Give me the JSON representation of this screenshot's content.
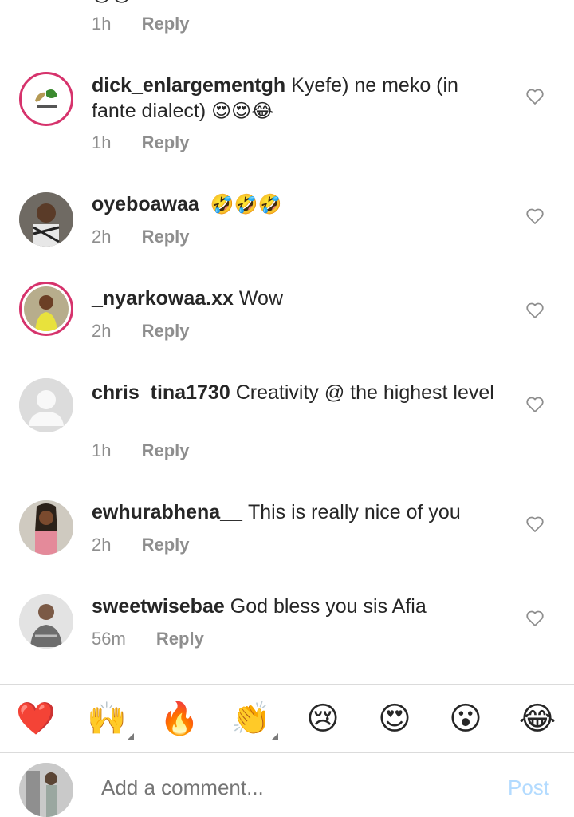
{
  "top_comment": {
    "time": "1h",
    "reply": "Reply",
    "emoji": "😍😍"
  },
  "comments": [
    {
      "username": "dick_enlargementgh",
      "text": "Kyefe) ne meko (in fante dialect)",
      "emoji": "😍😍😂",
      "time": "1h",
      "reply": "Reply"
    },
    {
      "username": "oyeboawaa",
      "text": "",
      "emoji": "🤣🤣🤣",
      "time": "2h",
      "reply": "Reply"
    },
    {
      "username": "_nyarkowaa.xx",
      "text": "Wow",
      "emoji": "",
      "time": "2h",
      "reply": "Reply"
    },
    {
      "username": "chris_tina1730",
      "text": "Creativity @ the highest level",
      "emoji": "",
      "time": "1h",
      "reply": "Reply"
    },
    {
      "username": "ewhurabhena__",
      "text": "This is really nice of you",
      "emoji": "",
      "time": "2h",
      "reply": "Reply"
    },
    {
      "username": "sweetwisebae",
      "text": "God bless you sis Afia",
      "emoji": "",
      "time": "56m",
      "reply": "Reply"
    }
  ],
  "reactions": [
    {
      "glyph": "❤️",
      "icon": "red-heart-icon"
    },
    {
      "glyph": "🙌",
      "icon": "raising-hands-icon"
    },
    {
      "glyph": "🔥",
      "icon": "fire-icon"
    },
    {
      "glyph": "👏",
      "icon": "clapping-hands-icon"
    },
    {
      "glyph": "😢",
      "icon": "crying-face-icon"
    },
    {
      "glyph": "😍",
      "icon": "heart-eyes-icon"
    },
    {
      "glyph": "😮",
      "icon": "surprised-face-icon"
    },
    {
      "glyph": "😂",
      "icon": "tears-of-joy-icon"
    }
  ],
  "composer": {
    "placeholder": "Add a comment...",
    "post_label": "Post"
  },
  "colors": {
    "story_ring": "#d6336c",
    "muted_text": "#8e8e8e",
    "post_disabled": "#b3dbff",
    "divider": "#dbdbdb"
  }
}
